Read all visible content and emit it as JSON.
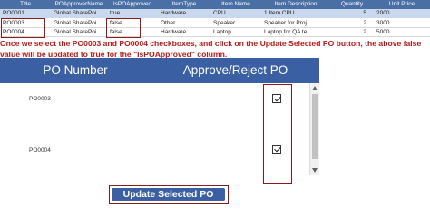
{
  "table": {
    "columns": [
      "Title",
      "POApproverName",
      "IsPOApproved",
      "ItemType",
      "Item Name",
      "Item Description",
      "Quantity",
      "Unit Price"
    ],
    "rows": [
      [
        "PO0001",
        "Global SharePoi...",
        "true",
        "Hardware",
        "CPU",
        "1 Item CPU",
        "5",
        "2000"
      ],
      [
        "PO0003",
        "Global SharePoi...",
        "false",
        "Other",
        "Speaker",
        "Speaker for Proj...",
        "2",
        "3000"
      ],
      [
        "PO0004",
        "Global SharePoi...",
        "false",
        "Hardware",
        "Laptop",
        "Laptop for QA te...",
        "2",
        "5000"
      ]
    ]
  },
  "note": {
    "line1": "Once we select the PO0003 and PO0004 checkboxes, and click on the Update Selected PO button, the above false",
    "line2": "value will be updated to true  for the \"IsPOApproved\" column."
  },
  "gallery": {
    "header_left": "PO Number",
    "header_right": "Approve/Reject PO",
    "items": [
      {
        "po": "PO0003",
        "checked": true
      },
      {
        "po": "PO0004",
        "checked": true
      }
    ]
  },
  "update_button": {
    "label": "Update Selected PO"
  },
  "colors": {
    "header_blue": "#3b5fa3",
    "note_red": "#b81818",
    "highlight_border": "#8b1a1a",
    "selected_row": "#c9d8ee"
  }
}
